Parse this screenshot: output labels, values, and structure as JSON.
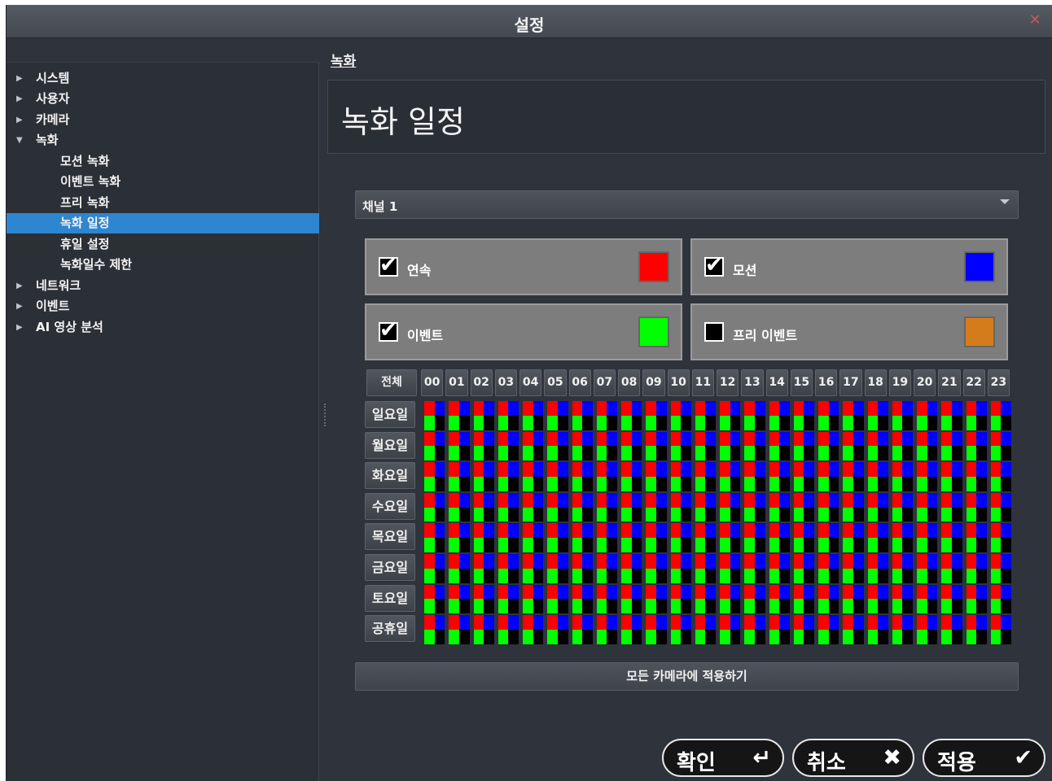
{
  "window": {
    "title": "설정",
    "close_glyph": "✕"
  },
  "sidebar": {
    "items": [
      {
        "label": "시스템",
        "arrow": "▶"
      },
      {
        "label": "사용자",
        "arrow": "▶"
      },
      {
        "label": "카메라",
        "arrow": "▶"
      },
      {
        "label": "녹화",
        "arrow": "▼"
      },
      {
        "label": "모션 녹화"
      },
      {
        "label": "이벤트 녹화"
      },
      {
        "label": "프리 녹화"
      },
      {
        "label": "녹화 일정"
      },
      {
        "label": "휴일 설정"
      },
      {
        "label": "녹화일수 제한"
      },
      {
        "label": "네트워크",
        "arrow": "▶"
      },
      {
        "label": "이벤트",
        "arrow": "▶"
      },
      {
        "label": "AI 영상 분석",
        "arrow": "▶"
      }
    ]
  },
  "breadcrumb": "녹화",
  "page_title": "녹화 일정",
  "channel": {
    "selected": "채널 1"
  },
  "legend": [
    {
      "label": "연속",
      "checked": true,
      "color": "#ff0000",
      "mark": "✔"
    },
    {
      "label": "모션",
      "checked": true,
      "color": "#0000ff",
      "mark": "✔"
    },
    {
      "label": "이벤트",
      "checked": true,
      "color": "#00ff00",
      "mark": "✔"
    },
    {
      "label": "프리 이벤트",
      "checked": false,
      "color": "#d47c1c",
      "mark": ""
    }
  ],
  "schedule": {
    "all_label": "전체",
    "hours": [
      "00",
      "01",
      "02",
      "03",
      "04",
      "05",
      "06",
      "07",
      "08",
      "09",
      "10",
      "11",
      "12",
      "13",
      "14",
      "15",
      "16",
      "17",
      "18",
      "19",
      "20",
      "21",
      "22",
      "23"
    ],
    "days": [
      "일요일",
      "월요일",
      "화요일",
      "수요일",
      "목요일",
      "금요일",
      "토요일",
      "공휴일"
    ],
    "pattern_colors": [
      "#ff0000",
      "#0000ff",
      "#00ff00",
      "#000000"
    ]
  },
  "apply_all_label": "모든 카메라에 적용하기",
  "buttons": {
    "ok": {
      "label": "확인",
      "icon": "↵"
    },
    "cancel": {
      "label": "취소",
      "icon": "✖"
    },
    "apply": {
      "label": "적용",
      "icon": "✔"
    }
  }
}
